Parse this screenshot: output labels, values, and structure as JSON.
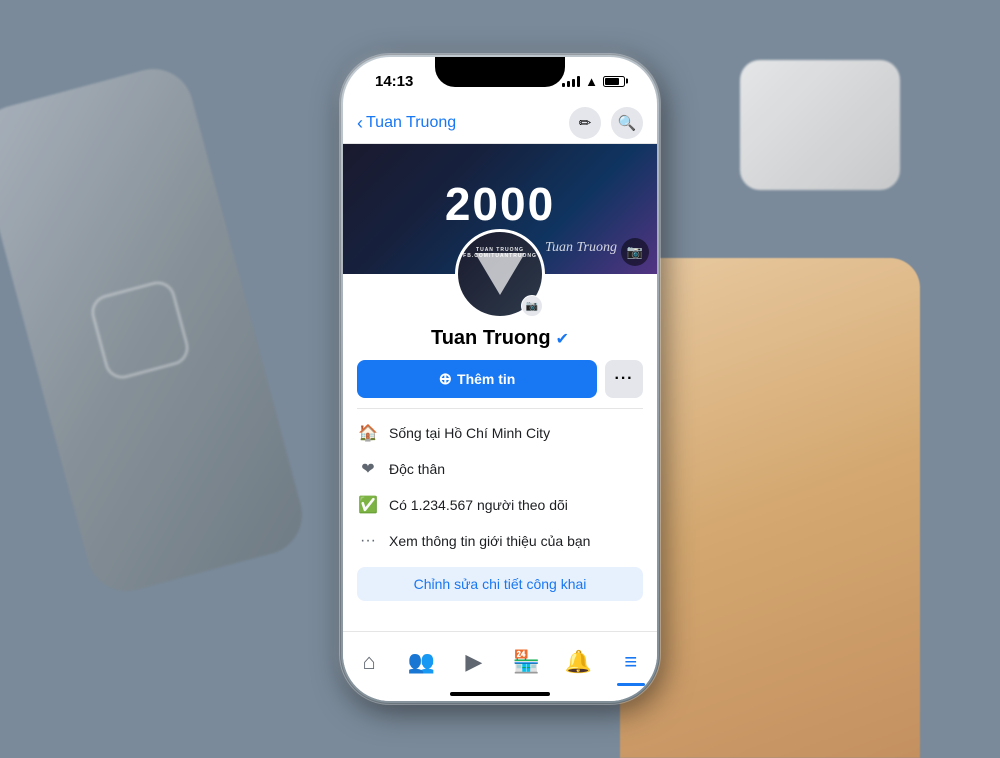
{
  "status_bar": {
    "time": "14:13"
  },
  "nav": {
    "back_label": "Tuan Truong",
    "edit_icon": "✏",
    "search_icon": "🔍"
  },
  "cover": {
    "big_number": "2000",
    "name_script": "Tuan Truong"
  },
  "profile": {
    "name": "Tuan Truong",
    "verified": true,
    "avatar_text1": "TUAN TRUONG",
    "avatar_text2": "FB.COM/TUANTRUONG"
  },
  "actions": {
    "add_info_label": "Thêm tin",
    "more_label": "···"
  },
  "info": {
    "location": "Sống tại Hồ Chí Minh City",
    "status": "Độc thân",
    "followers": "Có 1.234.567 người theo dõi",
    "more": "Xem thông tin giới thiệu của bạn",
    "edit_public": "Chỉnh sửa chi tiết công khai"
  },
  "bottom_nav": {
    "items": [
      {
        "icon": "⌂",
        "label": "home",
        "active": false
      },
      {
        "icon": "👥",
        "label": "friends",
        "active": false
      },
      {
        "icon": "▶",
        "label": "watch",
        "active": false
      },
      {
        "icon": "🏪",
        "label": "marketplace",
        "active": false
      },
      {
        "icon": "🔔",
        "label": "notifications",
        "active": false
      },
      {
        "icon": "≡",
        "label": "menu",
        "active": true
      }
    ]
  }
}
